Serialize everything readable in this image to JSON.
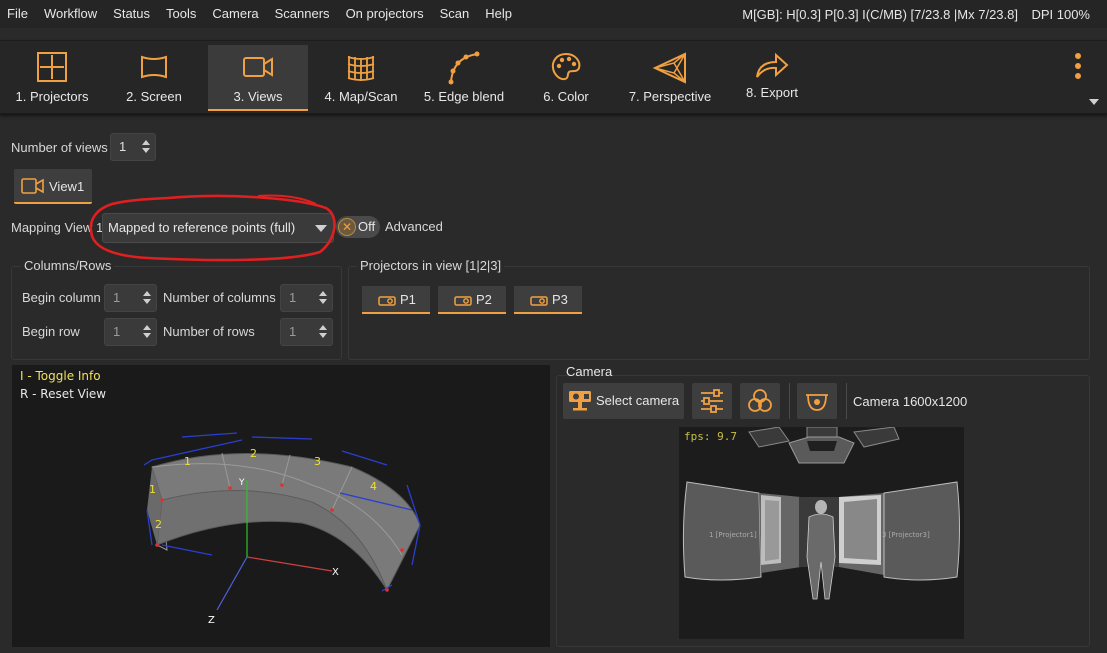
{
  "menu": [
    "File",
    "Workflow",
    "Status",
    "Tools",
    "Camera",
    "Scanners",
    "On projectors",
    "Scan",
    "Help"
  ],
  "status_info": "M[GB]: H[0.3] P[0.3] I(C/MB) [7/23.8 |Mx 7/23.8]",
  "dpi": "DPI 100%",
  "toolbar": {
    "items": [
      {
        "label": "1. Projectors",
        "icon": "grid-square-icon"
      },
      {
        "label": "2. Screen",
        "icon": "screen-icon"
      },
      {
        "label": "3. Views",
        "icon": "video-camera-icon",
        "active": true
      },
      {
        "label": "4. Map/Scan",
        "icon": "mesh-icon"
      },
      {
        "label": "5. Edge blend",
        "icon": "curve-icon"
      },
      {
        "label": "6. Color",
        "icon": "palette-icon"
      },
      {
        "label": "7. Perspective",
        "icon": "pyramid-icon"
      },
      {
        "label": "8. Export",
        "icon": "export-arrow-icon"
      }
    ]
  },
  "views": {
    "count_label": "Number of views",
    "count_value": "1",
    "view_button": "View1",
    "mapping_label": "Mapping View 1",
    "mapping_value": "Mapped to reference points (full)",
    "toggle_value": "Off",
    "advanced_label": "Advanced"
  },
  "columns_rows": {
    "title": "Columns/Rows",
    "begin_column_label": "Begin column",
    "begin_column": "1",
    "num_columns_label": "Number of columns",
    "num_columns": "1",
    "begin_row_label": "Begin row",
    "begin_row": "1",
    "num_rows_label": "Number of rows",
    "num_rows": "1"
  },
  "projectors": {
    "title": "Projectors in view [1|2|3]",
    "buttons": [
      "P1",
      "P2",
      "P3"
    ]
  },
  "view3d": {
    "hint1": "I - Toggle Info",
    "hint2": "R - Reset View",
    "markers": [
      "1",
      "2",
      "3",
      "4",
      "1",
      "2"
    ]
  },
  "camera": {
    "title": "Camera",
    "select_label": "Select camera",
    "resolution": "Camera 1600x1200",
    "fps": "fps: 9.7",
    "proj1_label": "1 [Projector1]",
    "proj3_label": "3 [Projector3]"
  },
  "colors": {
    "accent": "#f0a040",
    "background": "#2a2a2a",
    "annotation": "#e02020"
  }
}
